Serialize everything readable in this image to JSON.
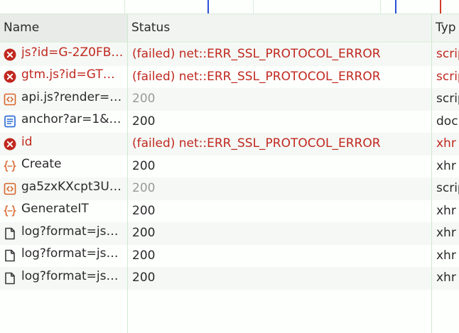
{
  "columns": {
    "name": "Name",
    "status": "Status",
    "type": "Typ"
  },
  "requests": [
    {
      "name": "js?id=G-2Z0FB…",
      "status": "(failed) net::ERR_SSL_PROTOCOL_ERROR",
      "type": "scrip",
      "icon": "error-icon",
      "state": "error"
    },
    {
      "name": "gtm.js?id=GT…",
      "status": "(failed) net::ERR_SSL_PROTOCOL_ERROR",
      "type": "scrip",
      "icon": "error-icon",
      "state": "error"
    },
    {
      "name": "api.js?render=…",
      "status": "200",
      "type": "scrip",
      "icon": "script-icon",
      "state": "cached"
    },
    {
      "name": "anchor?ar=1&…",
      "status": "200",
      "type": "doc",
      "icon": "document-icon",
      "state": "ok"
    },
    {
      "name": "id",
      "status": "(failed) net::ERR_SSL_PROTOCOL_ERROR",
      "type": "xhr",
      "icon": "error-icon",
      "state": "error"
    },
    {
      "name": "Create",
      "status": "200",
      "type": "xhr",
      "icon": "fetch-icon",
      "state": "ok"
    },
    {
      "name": "ga5zxKXcpt3U…",
      "status": "200",
      "type": "scrip",
      "icon": "script-icon",
      "state": "cached"
    },
    {
      "name": "GenerateIT",
      "status": "200",
      "type": "xhr",
      "icon": "fetch-icon",
      "state": "ok"
    },
    {
      "name": "log?format=js…",
      "status": "200",
      "type": "xhr",
      "icon": "file-icon",
      "state": "ok"
    },
    {
      "name": "log?format=js…",
      "status": "200",
      "type": "xhr",
      "icon": "file-icon",
      "state": "ok"
    },
    {
      "name": "log?format=js…",
      "status": "200",
      "type": "xhr",
      "icon": "file-icon",
      "state": "ok"
    }
  ],
  "colors": {
    "error": "#c0281f",
    "script": "#d8642a",
    "document": "#2f6fd6",
    "fetch": "#d8642a",
    "file": "#3a3a3a"
  }
}
